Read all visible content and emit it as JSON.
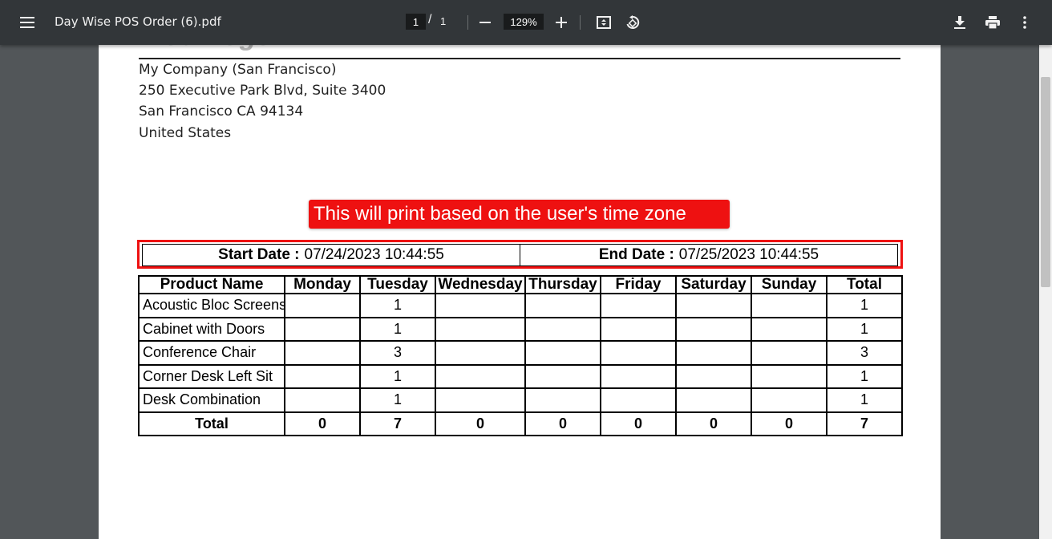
{
  "toolbar": {
    "filename": "Day Wise POS Order (6).pdf",
    "current_page": "1",
    "page_separator": "/",
    "total_pages": "1",
    "zoom": "129%",
    "icons": [
      "menu-icon",
      "zoom-out-icon",
      "zoom-in-icon",
      "fit-page-icon",
      "rotate-icon",
      "download-icon",
      "print-icon",
      "more-options-icon"
    ]
  },
  "document": {
    "logo_text": "Your logo",
    "company_lines": [
      "My Company (San Francisco)",
      "250 Executive Park Blvd, Suite 3400",
      "San Francisco CA 94134",
      "United States"
    ],
    "annotation": "This will print based on the user's time zone",
    "annotation_color": "#ee1111",
    "start_label": "Start Date :",
    "start_value": "07/24/2023 10:44:55",
    "end_label": "End Date :",
    "end_value": "07/25/2023 10:44:55",
    "table": {
      "headers": [
        "Product Name",
        "Monday",
        "Tuesday",
        "Wednesday",
        "Thursday",
        "Friday",
        "Saturday",
        "Sunday",
        "Total"
      ],
      "rows": [
        [
          "Acoustic Bloc Screens",
          "",
          "1",
          "",
          "",
          "",
          "",
          "",
          "1"
        ],
        [
          "Cabinet with Doors",
          "",
          "1",
          "",
          "",
          "",
          "",
          "",
          "1"
        ],
        [
          "Conference Chair",
          "",
          "3",
          "",
          "",
          "",
          "",
          "",
          "3"
        ],
        [
          "Corner Desk Left Sit",
          "",
          "1",
          "",
          "",
          "",
          "",
          "",
          "1"
        ],
        [
          "Desk Combination",
          "",
          "1",
          "",
          "",
          "",
          "",
          "",
          "1"
        ]
      ],
      "total_row": [
        "Total",
        "0",
        "7",
        "0",
        "0",
        "0",
        "0",
        "0",
        "7"
      ]
    }
  }
}
